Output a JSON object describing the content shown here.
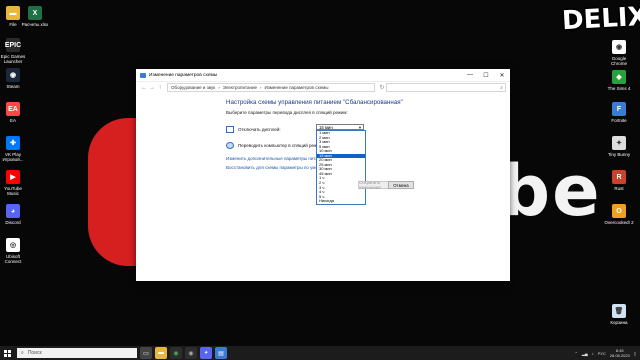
{
  "wallpaper": {
    "brand": "DELIX",
    "letters": "be"
  },
  "desktop_left": [
    {
      "label": "File",
      "icon": "folder-icon",
      "color": "#e8b73a",
      "glyph": "▬"
    },
    {
      "label": "Расчеты.xlsx",
      "icon": "excel-icon",
      "color": "#1e7145",
      "glyph": "X"
    },
    {
      "label": "Epic Games Launcher",
      "icon": "epic-games-icon",
      "color": "#2a2a2a",
      "glyph": "EPIC"
    },
    {
      "label": "Steam",
      "icon": "steam-icon",
      "color": "#1b2838",
      "glyph": "◉"
    },
    {
      "label": "EA",
      "icon": "ea-icon",
      "color": "#ff4747",
      "glyph": "EA"
    },
    {
      "label": "VK Play Игровой...",
      "icon": "vk-play-icon",
      "color": "#0077ff",
      "glyph": "✚"
    },
    {
      "label": "YouTube Music",
      "icon": "youtube-music-icon",
      "color": "#ff0000",
      "glyph": "▶"
    },
    {
      "label": "Discord",
      "icon": "discord-icon",
      "color": "#5865f2",
      "glyph": "◕"
    },
    {
      "label": "Ubisoft Connect",
      "icon": "ubisoft-icon",
      "color": "#ffffff",
      "glyph": "◎"
    }
  ],
  "desktop_right": [
    {
      "label": "Google Chrome",
      "icon": "chrome-icon",
      "color": "#ffffff",
      "glyph": "◉"
    },
    {
      "label": "The Sims 4",
      "icon": "sims-icon",
      "color": "#27a23a",
      "glyph": "◆"
    },
    {
      "label": "Fortnite",
      "icon": "fortnite-icon",
      "color": "#3a7bd5",
      "glyph": "F"
    },
    {
      "label": "Tiny Bunny",
      "icon": "tiny-bunny-icon",
      "color": "#ddd",
      "glyph": "✦"
    },
    {
      "label": "Rust",
      "icon": "rust-icon",
      "color": "#cd412b",
      "glyph": "R"
    },
    {
      "label": "Overcooked! 2",
      "icon": "overcooked-icon",
      "color": "#f0a020",
      "glyph": "O"
    },
    {
      "label": "Корзина",
      "icon": "recycle-bin-icon",
      "color": "#cfe3f5",
      "glyph": "🗑"
    }
  ],
  "window": {
    "title": "Изменение параметров схемы",
    "minimize": "—",
    "maximize": "☐",
    "close": "✕",
    "breadcrumb": [
      "Оборудование и звук",
      "›",
      "Электропитание",
      "›",
      "Изменение параметров схемы"
    ],
    "search_placeholder": "",
    "heading": "Настройка схемы управления питанием \"Сбалансированная\"",
    "subheading": "Выберите параметры перевода дисплея в спящий режим:",
    "display_label": "Отключать дисплей:",
    "sleep_label": "Переводить компьютер в спящий режим:",
    "link_advanced": "Изменить дополнительные параметры питания",
    "link_restore": "Восстановить для схемы параметры по умолчанию",
    "select_value": "15 мин",
    "dropdown_options": [
      "1 мин",
      "2 мин",
      "3 мин",
      "5 мин",
      "10 мин",
      "15 мин",
      "20 мин",
      "25 мин",
      "30 мин",
      "45 мин",
      "1 ч",
      "2 ч",
      "3 ч",
      "4 ч",
      "5 ч",
      "Никогда"
    ],
    "dropdown_selected_index": 5,
    "save_button": "Сохранить изменения",
    "cancel_button": "Отмена"
  },
  "taskbar": {
    "search_text": "Поиск",
    "language": "РУС",
    "time": "8:45",
    "date": "28.08.2023"
  }
}
